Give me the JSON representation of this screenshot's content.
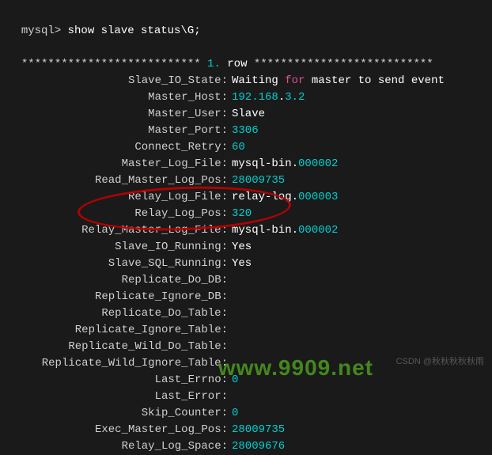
{
  "prompt": {
    "prefix": "mysql> ",
    "command": "show slave status\\G;"
  },
  "rowHeader": {
    "stars1": "***************************",
    "num": " 1. ",
    "rowText": "row ",
    "stars2": "***************************"
  },
  "fields": [
    {
      "label": "Slave_IO_State:",
      "parts": [
        {
          "t": "Waiting ",
          "c": "white"
        },
        {
          "t": "for",
          "c": "magenta"
        },
        {
          "t": " master to send event",
          "c": "white"
        }
      ]
    },
    {
      "label": "Master_Host:",
      "parts": [
        {
          "t": "192.168",
          "c": "cyan"
        },
        {
          "t": ".",
          "c": "white"
        },
        {
          "t": "3.2",
          "c": "cyan"
        }
      ]
    },
    {
      "label": "Master_User:",
      "parts": [
        {
          "t": "Slave",
          "c": "white"
        }
      ]
    },
    {
      "label": "Master_Port:",
      "parts": [
        {
          "t": "3306",
          "c": "cyan"
        }
      ]
    },
    {
      "label": "Connect_Retry:",
      "parts": [
        {
          "t": "60",
          "c": "cyan"
        }
      ]
    },
    {
      "label": "Master_Log_File:",
      "parts": [
        {
          "t": "mysql-bin.",
          "c": "white"
        },
        {
          "t": "000002",
          "c": "cyan"
        }
      ]
    },
    {
      "label": "Read_Master_Log_Pos:",
      "parts": [
        {
          "t": "28009735",
          "c": "cyan"
        }
      ]
    },
    {
      "label": "Relay_Log_File:",
      "parts": [
        {
          "t": "relay-log.",
          "c": "white"
        },
        {
          "t": "000003",
          "c": "cyan"
        }
      ]
    },
    {
      "label": "Relay_Log_Pos:",
      "parts": [
        {
          "t": "320",
          "c": "cyan"
        }
      ]
    },
    {
      "label": "Relay_Master_Log_File:",
      "parts": [
        {
          "t": "mysql-bin.",
          "c": "white"
        },
        {
          "t": "000002",
          "c": "cyan"
        }
      ]
    },
    {
      "label": "Slave_IO_Running:",
      "parts": [
        {
          "t": "Yes",
          "c": "white"
        }
      ]
    },
    {
      "label": "Slave_SQL_Running:",
      "parts": [
        {
          "t": "Yes",
          "c": "white"
        }
      ]
    },
    {
      "label": "Replicate_Do_DB:",
      "parts": []
    },
    {
      "label": "Replicate_Ignore_DB:",
      "parts": []
    },
    {
      "label": "Replicate_Do_Table:",
      "parts": []
    },
    {
      "label": "Replicate_Ignore_Table:",
      "parts": []
    },
    {
      "label": "Replicate_Wild_Do_Table:",
      "parts": []
    },
    {
      "label": "Replicate_Wild_Ignore_Table:",
      "parts": []
    },
    {
      "label": "Last_Errno:",
      "parts": [
        {
          "t": "0",
          "c": "cyan"
        }
      ]
    },
    {
      "label": "Last_Error:",
      "parts": []
    },
    {
      "label": "Skip_Counter:",
      "parts": [
        {
          "t": "0",
          "c": "cyan"
        }
      ]
    },
    {
      "label": "Exec_Master_Log_Pos:",
      "parts": [
        {
          "t": "28009735",
          "c": "cyan"
        }
      ]
    },
    {
      "label": "Relay_Log_Space:",
      "parts": [
        {
          "t": "28009676",
          "c": "cyan"
        }
      ]
    }
  ],
  "watermarks": {
    "site": "www.9909.net",
    "csdn": "CSDN @秋秋秋秋秋雨"
  }
}
